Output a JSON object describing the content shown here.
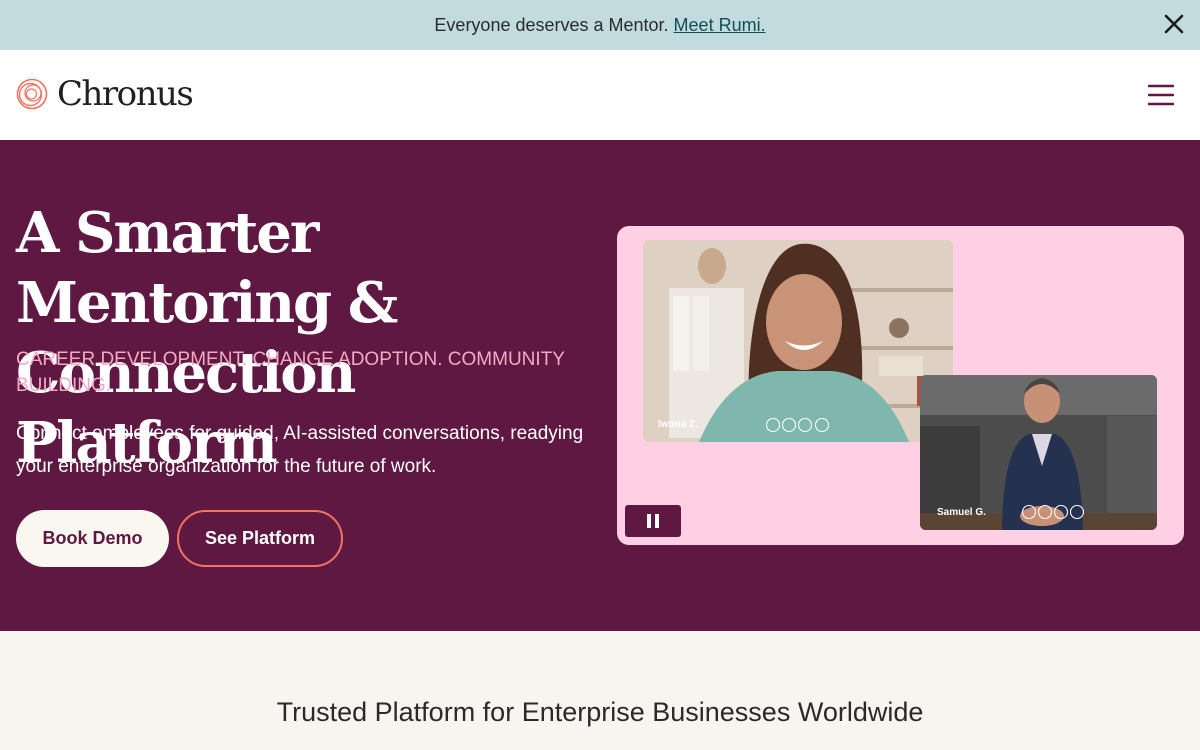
{
  "announcement": {
    "text": "Everyone deserves a Mentor.",
    "link_label": "Meet Rumi."
  },
  "header": {
    "brand": "Chronus"
  },
  "hero": {
    "title_line1": "A Smarter Mentoring &",
    "title_line2": "Connection Platform",
    "subtitle": "CAREER DEVELOPMENT. CHANGE ADOPTION. COMMUNITY BUILDING.",
    "description": "Connect employees for guided, AI-assisted conversations, readying your enterprise organization for the future of work.",
    "primary_button": "Book Demo",
    "secondary_button": "See Platform",
    "video": {
      "participant_1": "Iwona Z.",
      "participant_2": "Samuel G."
    }
  },
  "trusted": {
    "heading": "Trusted Platform for Enterprise Businesses Worldwide"
  },
  "colors": {
    "hero_bg": "#5e1841",
    "accent_coral": "#ef7561",
    "announce_bg": "#c2dbde",
    "video_card_bg": "#ffd0e4"
  }
}
